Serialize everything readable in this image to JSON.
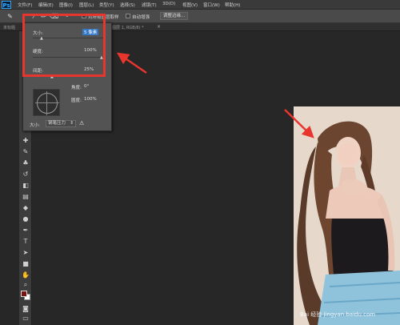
{
  "app": {
    "logo": "Ps"
  },
  "menu": [
    "文件(F)",
    "编辑(E)",
    "图像(I)",
    "图层(L)",
    "类型(Y)",
    "选择(S)",
    "滤镜(T)",
    "3D(D)",
    "视图(V)",
    "窗口(W)",
    "帮助(H)"
  ],
  "options_bar": {
    "tool_icons": [
      "brush-icon",
      "brush-mode-icon",
      "pen-icon",
      "eraser-icon"
    ],
    "zoom_text": "9",
    "fill_text": "对所有图层取样",
    "auto_enhance": "自动增强",
    "refine_button": "调整边缘..."
  },
  "doc_tab": {
    "left_label": "未标题",
    "title": "图层 1, RGB/8) *",
    "close": "×"
  },
  "brush_panel": {
    "size_label": "大小:",
    "size_value": "5 像素",
    "hardness_label": "硬度:",
    "hardness_value": "100%",
    "spacing_label": "间距:",
    "spacing_value": "25%",
    "angle_label": "角度:",
    "angle_value": "0°",
    "roundness_label": "圆度:",
    "roundness_value": "100%",
    "size_mode_label": "大小:",
    "size_mode_value": "钢笔压力",
    "warning_icon": "warning-icon"
  },
  "colors": {
    "highlight": "#e8362f",
    "foreground": "#7a1212",
    "background": "#ffffff",
    "accent": "#3478c6"
  },
  "watermark": {
    "text": "Bai 经验",
    "url": "jingyan.baidu.com"
  }
}
